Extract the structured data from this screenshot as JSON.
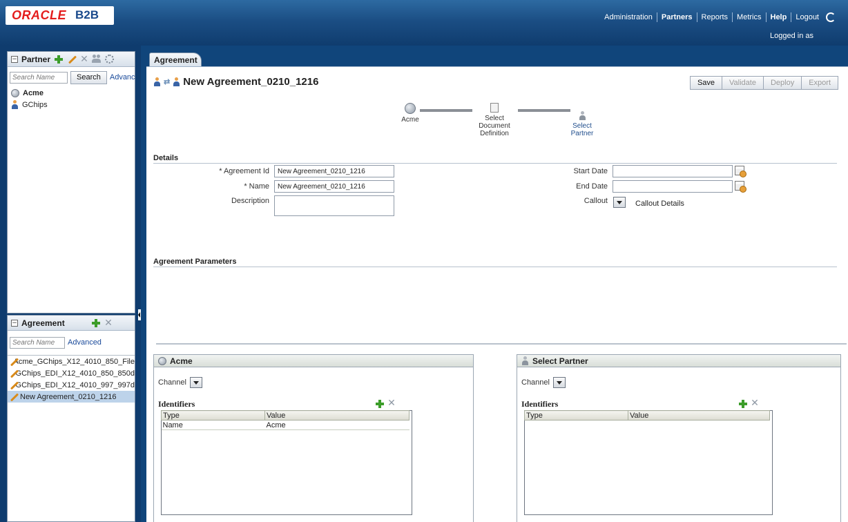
{
  "header": {
    "logo_brand": "ORACLE",
    "logo_product": "B2B",
    "nav": [
      "Administration",
      "Partners",
      "Reports",
      "Metrics",
      "Help",
      "Logout"
    ],
    "active_nav": "Partners",
    "logged_in": "Logged in as"
  },
  "partner_panel": {
    "title": "Partner",
    "search_placeholder": "Search Name",
    "search_button": "Search",
    "advanced_link": "Advanc",
    "items": [
      "Acme",
      "GChips"
    ]
  },
  "agreement_panel": {
    "title": "Agreement",
    "search_placeholder": "Search Name",
    "advanced_link": "Advanced",
    "items": [
      "Acme_GChips_X12_4010_850_File",
      "GChips_EDI_X12_4010_850_850d",
      "GChips_EDI_X12_4010_997_997d",
      "New Agreement_0210_1216"
    ],
    "selected_index": 3
  },
  "tab": {
    "label": "Agreement"
  },
  "main": {
    "title": "New Agreement_0210_1216",
    "toolbar": {
      "save": "Save",
      "validate": "Validate",
      "deploy": "Deploy",
      "export": "Export"
    },
    "train": {
      "host": "Acme",
      "doc_def": [
        "Select",
        "Document",
        "Definition"
      ],
      "partner": [
        "Select",
        "Partner"
      ]
    },
    "details": {
      "section": "Details",
      "agreement_id_label": "* Agreement Id",
      "agreement_id_value": "New Agreement_0210_1216",
      "name_label": "* Name",
      "name_value": "New Agreement_0210_1216",
      "description_label": "Description",
      "start_date_label": "Start Date",
      "end_date_label": "End Date",
      "callout_label": "Callout",
      "callout_details": "Callout Details"
    },
    "params_section": "Agreement Parameters",
    "host_box": {
      "title": "Acme",
      "channel_label": "Channel",
      "identifiers_label": "Identifiers",
      "columns": [
        "Type",
        "Value"
      ],
      "rows": [
        [
          "Name",
          "Acme"
        ]
      ]
    },
    "partner_box": {
      "title": "Select Partner",
      "channel_label": "Channel",
      "identifiers_label": "Identifiers",
      "columns": [
        "Type",
        "Value"
      ],
      "rows": []
    }
  }
}
